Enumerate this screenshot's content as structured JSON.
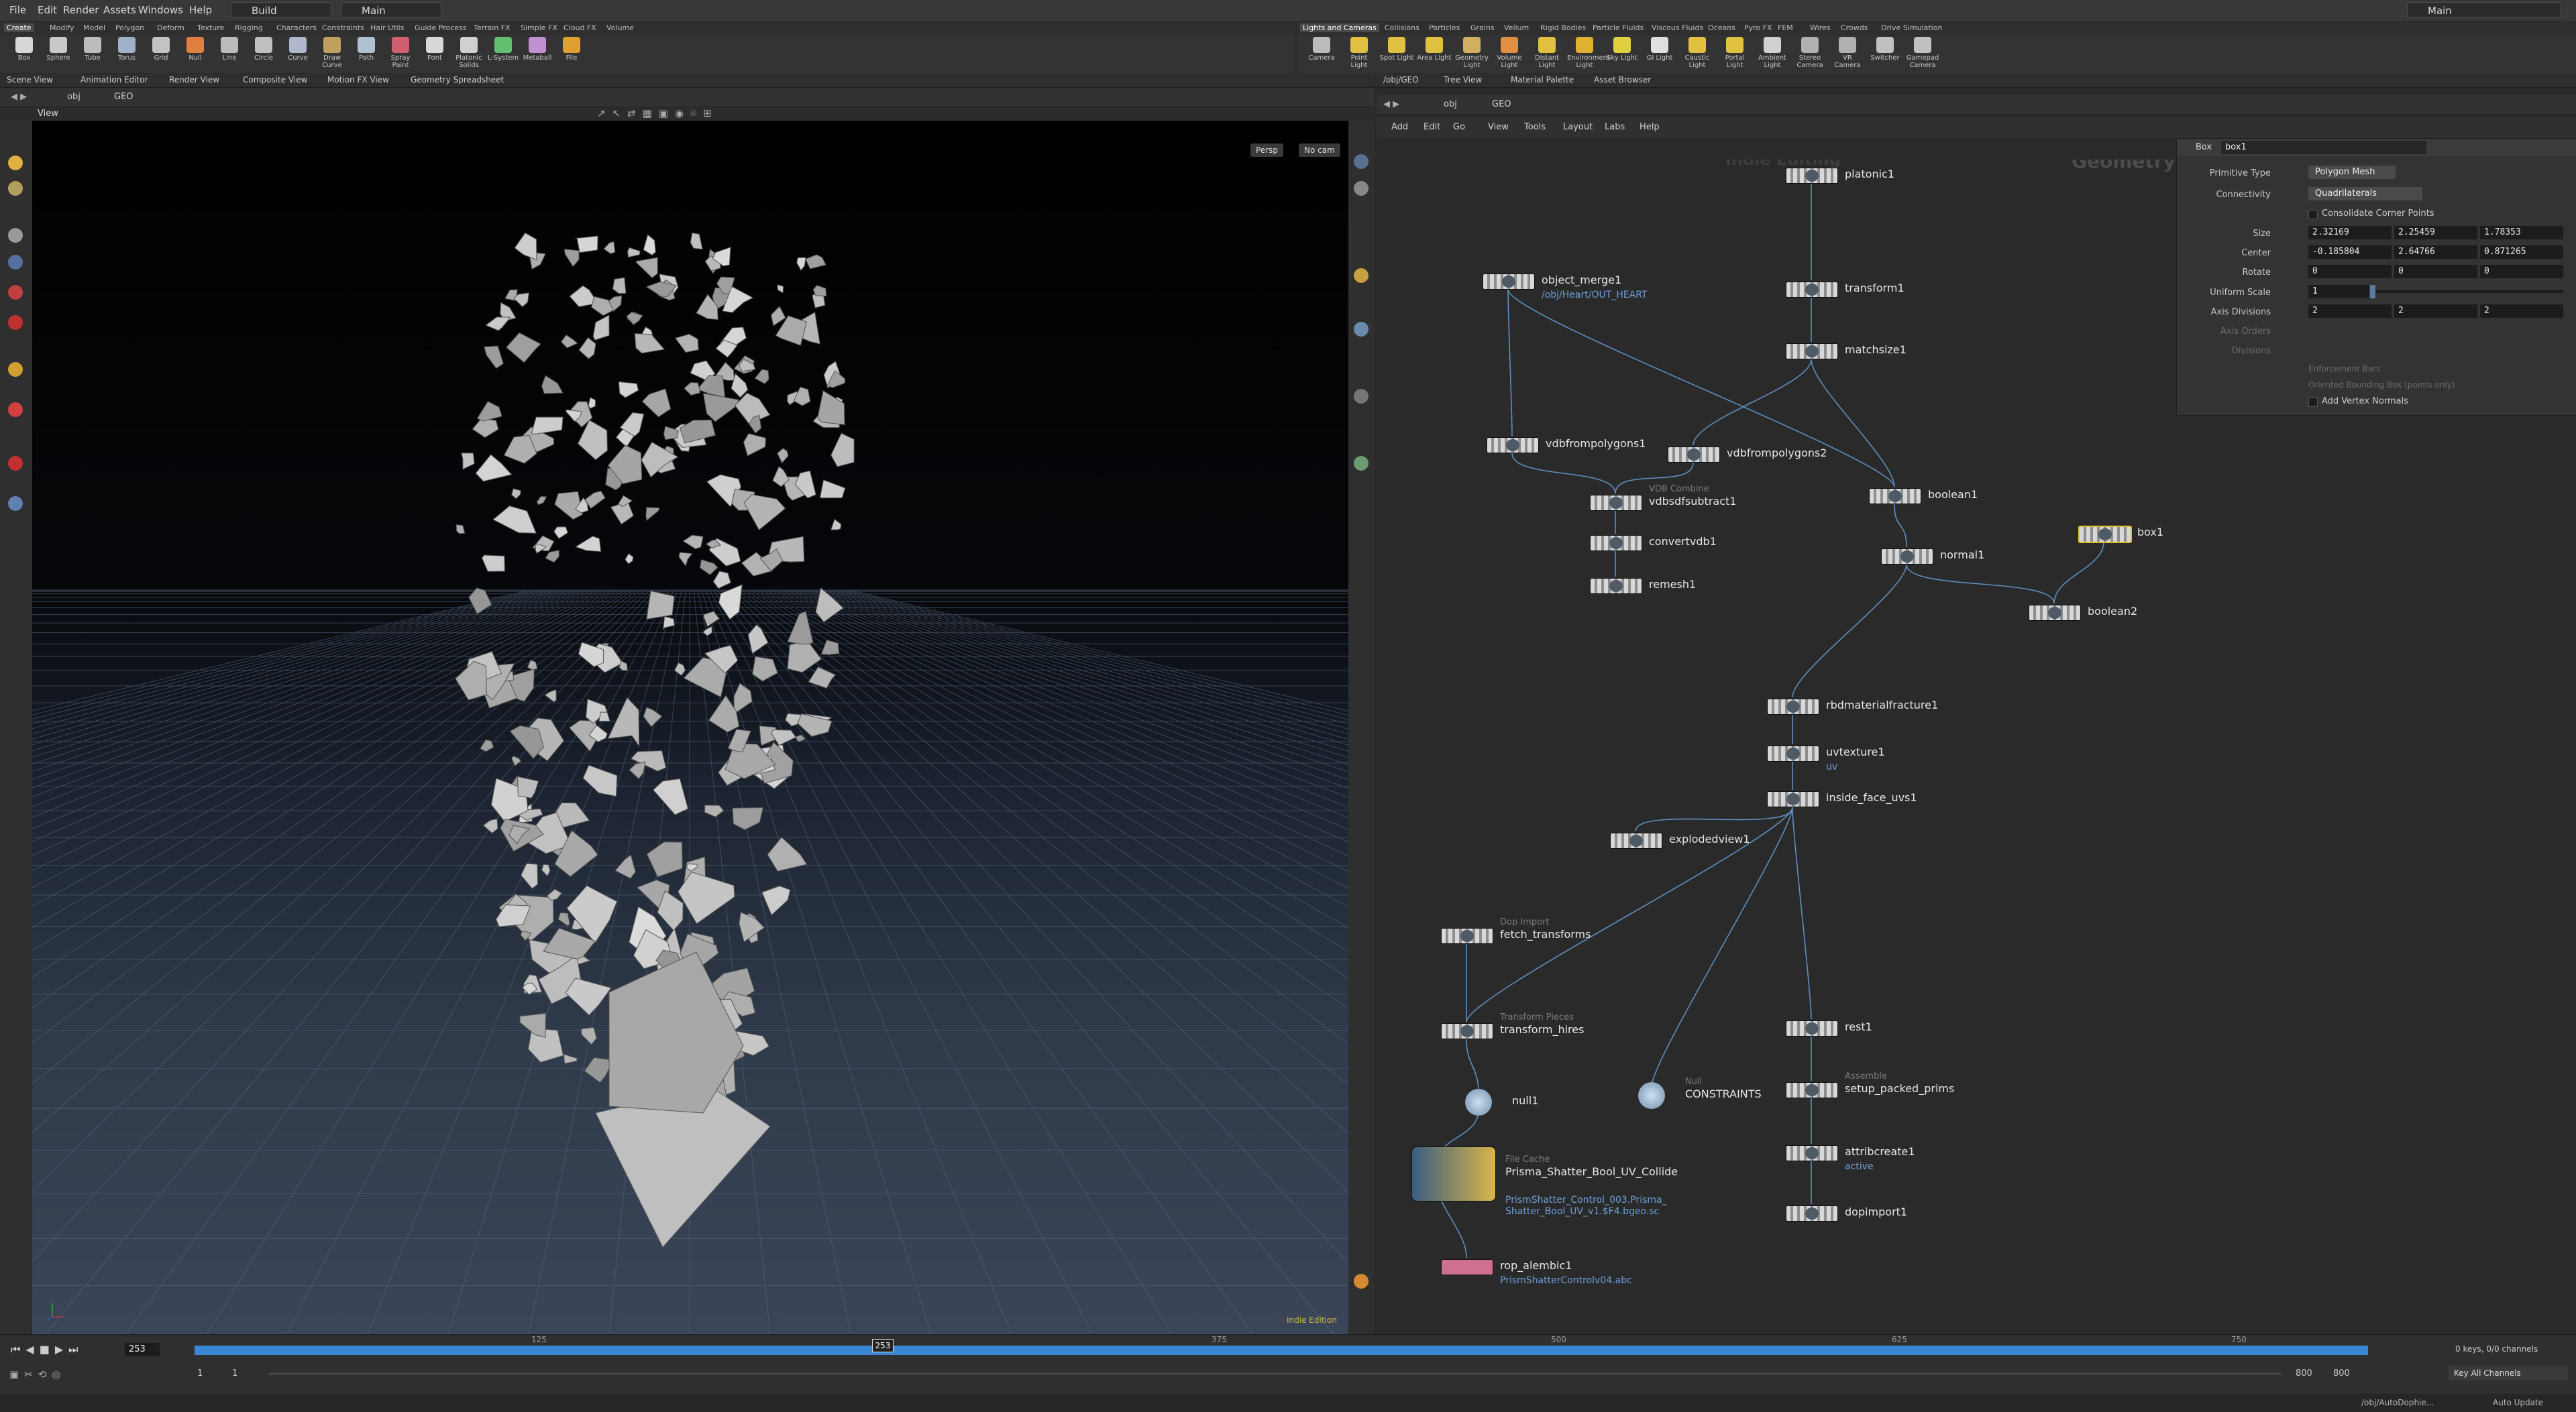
{
  "menubar": {
    "items": [
      "File",
      "Edit",
      "Render",
      "Assets",
      "Windows",
      "Help"
    ],
    "desktop": "Build",
    "context": "Main",
    "right_desktop": "Main"
  },
  "shelf_left": {
    "tabs": [
      "Create",
      "Modify",
      "Model",
      "Polygon",
      "Deform",
      "Texture",
      "Rigging",
      "Characters",
      "Constraints",
      "Hair Utils",
      "Guide Process",
      "Terrain FX",
      "Simple FX",
      "Cloud FX",
      "Volume"
    ],
    "tools": [
      "Box",
      "Sphere",
      "Tube",
      "Torus",
      "Grid",
      "Null",
      "Line",
      "Circle",
      "Curve",
      "Draw Curve",
      "Path",
      "Spray Paint",
      "Font",
      "Platonic Solids",
      "L-System",
      "Metaball",
      "File"
    ]
  },
  "shelf_right": {
    "tabs": [
      "Lights and Cameras",
      "Collisions",
      "Particles",
      "Grains",
      "Vellum",
      "Rigid Bodies",
      "Particle Fluids",
      "Viscous Fluids",
      "Oceans",
      "Pyro FX",
      "FEM",
      "Wires",
      "Crowds",
      "Drive Simulation"
    ],
    "tools": [
      "Camera",
      "Point Light",
      "Spot Light",
      "Area Light",
      "Geometry Light",
      "Volume Light",
      "Distant Light",
      "Environment Light",
      "Sky Light",
      "GI Light",
      "Caustic Light",
      "Portal Light",
      "Ambient Light",
      "Stereo Camera",
      "VR Camera",
      "Switcher",
      "Gamepad Camera"
    ]
  },
  "left_pane": {
    "tabs": [
      "Scene View",
      "Animation Editor",
      "Render View",
      "Composite View",
      "Motion FX View",
      "Geometry Spreadsheet"
    ],
    "path": [
      "obj",
      "GEO"
    ],
    "view_label": "View",
    "persp": "Persp",
    "cam": "No cam",
    "watermark": "Indie Edition"
  },
  "right_pane": {
    "tabs": [
      "/obj/GEO",
      "Tree View",
      "Material Palette",
      "Asset Browser"
    ],
    "path": [
      "obj",
      "GEO"
    ],
    "menu": [
      "Add",
      "Edit",
      "Go",
      "View",
      "Tools",
      "Layout",
      "Labs",
      "Help"
    ],
    "watermark": "Indie Editing",
    "context_label": "Geometry"
  },
  "nodes": [
    {
      "name": "platonic1",
      "type": "",
      "sub": ""
    },
    {
      "name": "transform1",
      "type": "",
      "sub": ""
    },
    {
      "name": "matchsize1",
      "type": "",
      "sub": ""
    },
    {
      "name": "object_merge1",
      "type": "",
      "sub": "/obj/Heart/OUT_HEART"
    },
    {
      "name": "vdbfrompolygons1",
      "type": "",
      "sub": ""
    },
    {
      "name": "vdbfrompolygons2",
      "type": "",
      "sub": ""
    },
    {
      "name": "vdbsdfsubtract1",
      "type": "VDB Combine",
      "sub": ""
    },
    {
      "name": "convertvdb1",
      "type": "",
      "sub": ""
    },
    {
      "name": "remesh1",
      "type": "",
      "sub": ""
    },
    {
      "name": "boolean1",
      "type": "",
      "sub": ""
    },
    {
      "name": "normal1",
      "type": "",
      "sub": ""
    },
    {
      "name": "box1",
      "type": "",
      "sub": ""
    },
    {
      "name": "boolean2",
      "type": "",
      "sub": ""
    },
    {
      "name": "rbdmaterialfracture1",
      "type": "",
      "sub": ""
    },
    {
      "name": "uvtexture1",
      "type": "",
      "sub": "uv"
    },
    {
      "name": "inside_face_uvs1",
      "type": "",
      "sub": ""
    },
    {
      "name": "explodedview1",
      "type": "",
      "sub": ""
    },
    {
      "name": "fetch_transforms",
      "type": "Dop Import",
      "sub": ""
    },
    {
      "name": "transform_hires",
      "type": "Transform Pieces",
      "sub": ""
    },
    {
      "name": "rest1",
      "type": "",
      "sub": ""
    },
    {
      "name": "null1",
      "type": "",
      "sub": ""
    },
    {
      "name": "CONSTRAINTS",
      "type": "Null",
      "sub": ""
    },
    {
      "name": "setup_packed_prims",
      "type": "Assemble",
      "sub": ""
    },
    {
      "name": "attribcreate1",
      "type": "",
      "sub": "active"
    },
    {
      "name": "Prisma_Shatter_Bool_UV_Collide",
      "type": "File Cache",
      "sub": "PrismShatter_Control_003.Prisma_ Shatter_Bool_UV_v1.$F4.bgeo.sc"
    },
    {
      "name": "dopimport1",
      "type": "",
      "sub": ""
    },
    {
      "name": "rop_alembic1",
      "type": "",
      "sub": "PrismShatterControlv04.abc"
    }
  ],
  "params": {
    "node_type": "Box",
    "node_name": "box1",
    "rows": [
      {
        "label": "Primitive Type",
        "value": "Polygon Mesh"
      },
      {
        "label": "Connectivity",
        "value": "Quadrilaterals"
      }
    ],
    "consolidate": "Consolidate Corner Points",
    "size_label": "Size",
    "size": [
      "2.32169",
      "2.25459",
      "1.78353"
    ],
    "center_label": "Center",
    "center": [
      "-0.185804",
      "2.64766",
      "0.871265"
    ],
    "rotate_label": "Rotate",
    "rotate": [
      "0",
      "0",
      "0"
    ],
    "uniform_label": "Uniform Scale",
    "uniform": "1",
    "axis_div_label": "Axis Divisions",
    "axis_div": [
      "2",
      "2",
      "2"
    ],
    "axis_orders_label": "Axis Orders",
    "divisions_label": "Divisions",
    "enforce": "Enforcement Bars",
    "oriented": "Oriented Bounding Box (points only)",
    "vertex_normals": "Add Vertex Normals"
  },
  "timeline": {
    "frame": "253",
    "ticks": [
      "125",
      "375",
      "500",
      "625",
      "750"
    ],
    "start": "1",
    "start2": "1",
    "end": "800",
    "end2": "800",
    "keys": "0 keys, 0/0 channels",
    "key_all": "Key All Channels",
    "status_path": "/obj/AutoDophie...",
    "auto_update": "Auto Update"
  },
  "colors": {
    "accent_blue": "#3b87d6",
    "wire_blue": "#5f8fbf",
    "selected_node": "#e1c033",
    "rop_pink": "#d07090"
  }
}
